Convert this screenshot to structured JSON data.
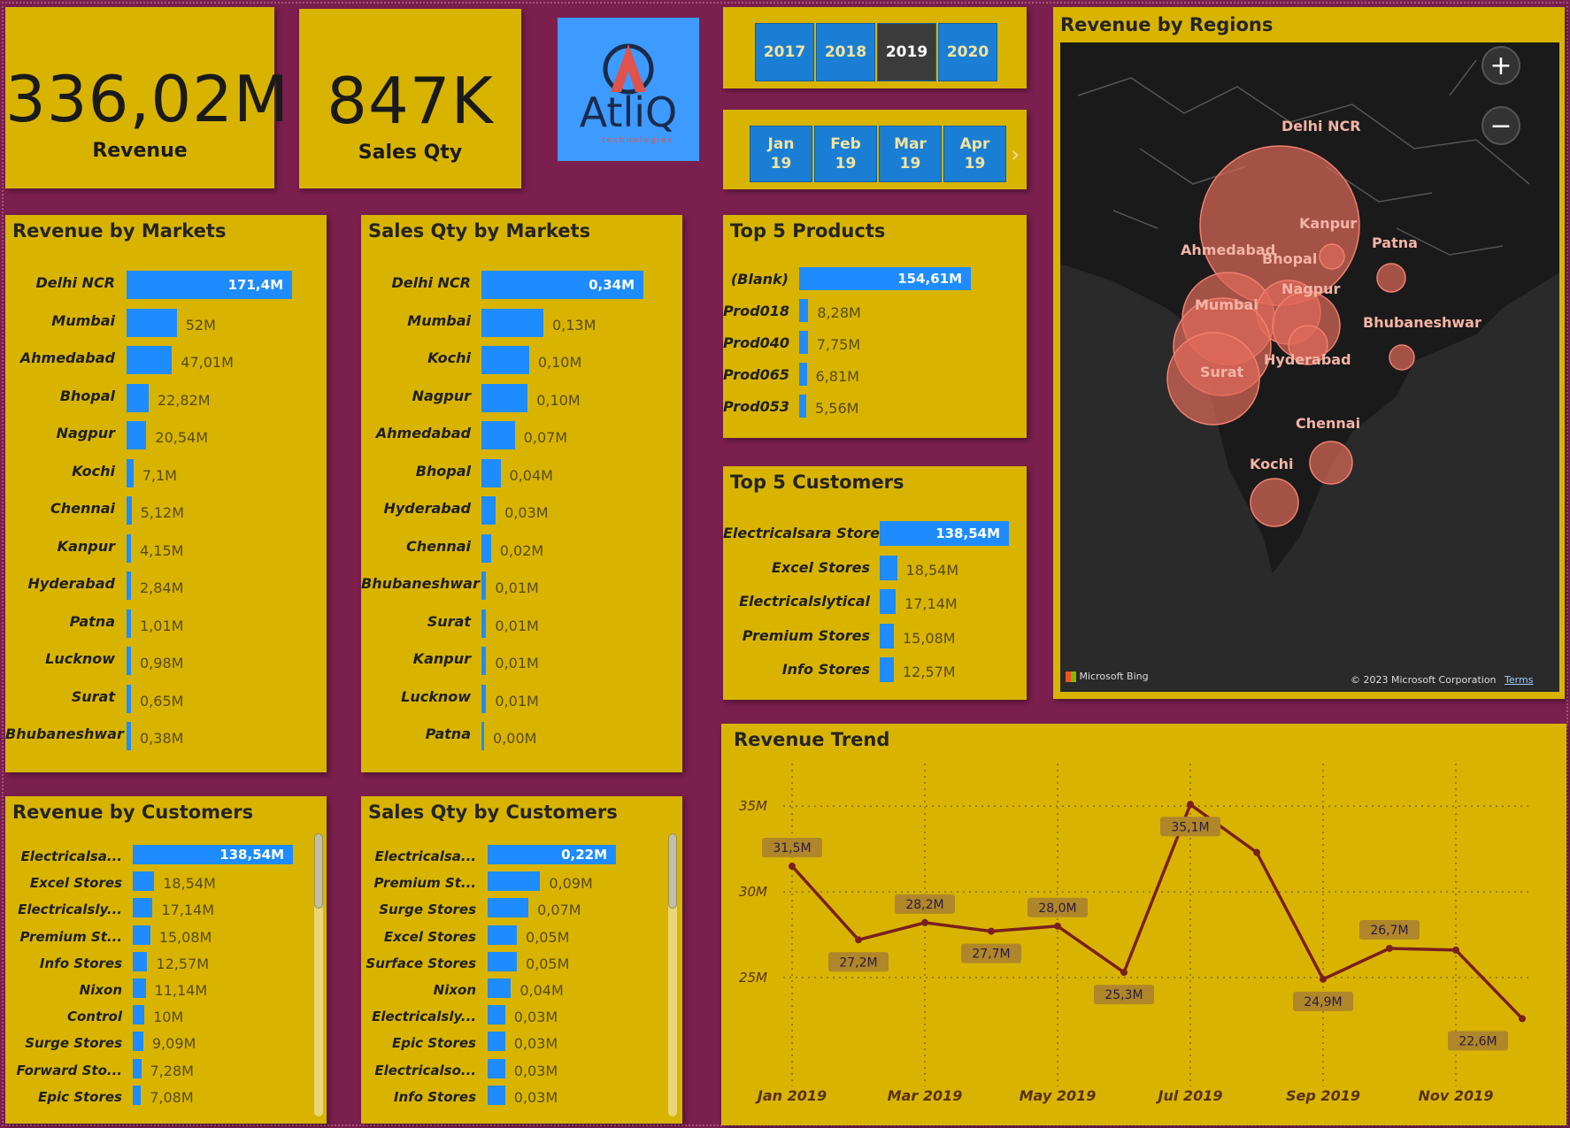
{
  "kpis": {
    "revenue": {
      "value": "336,02M",
      "label": "Revenue"
    },
    "sales_qty": {
      "value": "847K",
      "label": "Sales Qty"
    }
  },
  "logo": {
    "text": "AtliQ",
    "subtext": "technologies"
  },
  "year_slicer": {
    "options": [
      "2017",
      "2018",
      "2019",
      "2020"
    ],
    "selected": "2019"
  },
  "month_slicer": {
    "options": [
      {
        "m": "Jan",
        "y": "19"
      },
      {
        "m": "Feb",
        "y": "19"
      },
      {
        "m": "Mar",
        "y": "19"
      },
      {
        "m": "Apr",
        "y": "19"
      }
    ],
    "next_icon": "chevron-right-icon"
  },
  "revenue_by_markets": {
    "title": "Revenue by Markets",
    "rows": [
      {
        "label": "Delhi NCR",
        "value": 171.4,
        "text": "171,4M"
      },
      {
        "label": "Mumbai",
        "value": 52,
        "text": "52M"
      },
      {
        "label": "Ahmedabad",
        "value": 47.01,
        "text": "47,01M"
      },
      {
        "label": "Bhopal",
        "value": 22.82,
        "text": "22,82M"
      },
      {
        "label": "Nagpur",
        "value": 20.54,
        "text": "20,54M"
      },
      {
        "label": "Kochi",
        "value": 7.1,
        "text": "7,1M"
      },
      {
        "label": "Chennai",
        "value": 5.12,
        "text": "5,12M"
      },
      {
        "label": "Kanpur",
        "value": 4.15,
        "text": "4,15M"
      },
      {
        "label": "Hyderabad",
        "value": 2.84,
        "text": "2,84M"
      },
      {
        "label": "Patna",
        "value": 1.01,
        "text": "1,01M"
      },
      {
        "label": "Lucknow",
        "value": 0.98,
        "text": "0,98M"
      },
      {
        "label": "Surat",
        "value": 0.65,
        "text": "0,65M"
      },
      {
        "label": "Bhubaneshwar",
        "value": 0.38,
        "text": "0,38M"
      }
    ]
  },
  "sales_qty_by_markets": {
    "title": "Sales Qty by Markets",
    "rows": [
      {
        "label": "Delhi NCR",
        "value": 0.34,
        "text": "0,34M"
      },
      {
        "label": "Mumbai",
        "value": 0.13,
        "text": "0,13M"
      },
      {
        "label": "Kochi",
        "value": 0.1,
        "text": "0,10M"
      },
      {
        "label": "Nagpur",
        "value": 0.097,
        "text": "0,10M"
      },
      {
        "label": "Ahmedabad",
        "value": 0.07,
        "text": "0,07M"
      },
      {
        "label": "Bhopal",
        "value": 0.04,
        "text": "0,04M"
      },
      {
        "label": "Hyderabad",
        "value": 0.03,
        "text": "0,03M"
      },
      {
        "label": "Chennai",
        "value": 0.02,
        "text": "0,02M"
      },
      {
        "label": "Bhubaneshwar",
        "value": 0.01,
        "text": "0,01M"
      },
      {
        "label": "Surat",
        "value": 0.01,
        "text": "0,01M"
      },
      {
        "label": "Kanpur",
        "value": 0.01,
        "text": "0,01M"
      },
      {
        "label": "Lucknow",
        "value": 0.01,
        "text": "0,01M"
      },
      {
        "label": "Patna",
        "value": 0.004,
        "text": "0,00M"
      }
    ]
  },
  "top5_products": {
    "title": "Top 5 Products",
    "rows": [
      {
        "label": "(Blank)",
        "value": 154.61,
        "text": "154,61M"
      },
      {
        "label": "Prod018",
        "value": 8.28,
        "text": "8,28M"
      },
      {
        "label": "Prod040",
        "value": 7.75,
        "text": "7,75M"
      },
      {
        "label": "Prod065",
        "value": 6.81,
        "text": "6,81M"
      },
      {
        "label": "Prod053",
        "value": 5.56,
        "text": "5,56M"
      }
    ]
  },
  "top5_customers": {
    "title": "Top 5 Customers",
    "rows": [
      {
        "label": "Electricalsara Stores",
        "value": 138.54,
        "text": "138,54M"
      },
      {
        "label": "Excel Stores",
        "value": 18.54,
        "text": "18,54M"
      },
      {
        "label": "Electricalslytical",
        "value": 17.14,
        "text": "17,14M"
      },
      {
        "label": "Premium Stores",
        "value": 15.08,
        "text": "15,08M"
      },
      {
        "label": "Info Stores",
        "value": 12.57,
        "text": "12,57M"
      }
    ]
  },
  "revenue_by_customers": {
    "title": "Revenue by Customers",
    "scroll_position": 0.0,
    "rows": [
      {
        "label": "Electricalsa...",
        "value": 138.54,
        "text": "138,54M"
      },
      {
        "label": "Excel Stores",
        "value": 18.54,
        "text": "18,54M"
      },
      {
        "label": "Electricalsly...",
        "value": 17.14,
        "text": "17,14M"
      },
      {
        "label": "Premium St...",
        "value": 15.08,
        "text": "15,08M"
      },
      {
        "label": "Info Stores",
        "value": 12.57,
        "text": "12,57M"
      },
      {
        "label": "Nixon",
        "value": 11.14,
        "text": "11,14M"
      },
      {
        "label": "Control",
        "value": 10,
        "text": "10M"
      },
      {
        "label": "Surge Stores",
        "value": 9.09,
        "text": "9,09M"
      },
      {
        "label": "Forward Sto...",
        "value": 7.28,
        "text": "7,28M"
      },
      {
        "label": "Epic Stores",
        "value": 7.08,
        "text": "7,08M"
      }
    ]
  },
  "sales_qty_by_customers": {
    "title": "Sales Qty by Customers",
    "scroll_position": 0.0,
    "rows": [
      {
        "label": "Electricalsa...",
        "value": 0.22,
        "text": "0,22M"
      },
      {
        "label": "Premium St...",
        "value": 0.09,
        "text": "0,09M"
      },
      {
        "label": "Surge Stores",
        "value": 0.07,
        "text": "0,07M"
      },
      {
        "label": "Excel Stores",
        "value": 0.05,
        "text": "0,05M"
      },
      {
        "label": "Surface Stores",
        "value": 0.05,
        "text": "0,05M"
      },
      {
        "label": "Nixon",
        "value": 0.04,
        "text": "0,04M"
      },
      {
        "label": "Electricalsly...",
        "value": 0.03,
        "text": "0,03M"
      },
      {
        "label": "Epic Stores",
        "value": 0.03,
        "text": "0,03M"
      },
      {
        "label": "Electricalso...",
        "value": 0.03,
        "text": "0,03M"
      },
      {
        "label": "Info Stores",
        "value": 0.03,
        "text": "0,03M"
      }
    ]
  },
  "revenue_by_regions": {
    "title": "Revenue by Regions",
    "cities": [
      "Delhi NCR",
      "Kanpur",
      "Patna",
      "Ahmedabad",
      "Bhopal",
      "Nagpur",
      "Mumbai",
      "Bhubaneshwar",
      "Hyderabad",
      "Surat",
      "Chennai",
      "Kochi"
    ],
    "zoom_in_icon": "plus-icon",
    "zoom_out_icon": "minus-icon",
    "attribution_left": "Microsoft Bing",
    "attribution_right": "© 2023 Microsoft Corporation",
    "terms": "Terms"
  },
  "colors": {
    "card_bg": "#d8b400",
    "page_bg": "#7b1f4e",
    "bar": "#1e8cff",
    "trend_line": "#7a1f1f",
    "map_bubble": "#e0695a"
  },
  "chart_data": {
    "type": "line",
    "title": "Revenue Trend",
    "x": [
      "Jan 2019",
      "Feb 2019",
      "Mar 2019",
      "Apr 2019",
      "May 2019",
      "Jun 2019",
      "Jul 2019",
      "Aug 2019",
      "Sep 2019",
      "Oct 2019",
      "Nov 2019",
      "Dec 2019"
    ],
    "x_tick_labels": [
      "Jan 2019",
      "Mar 2019",
      "May 2019",
      "Jul 2019",
      "Sep 2019",
      "Nov 2019"
    ],
    "values": [
      31.5,
      27.2,
      28.2,
      27.7,
      28.0,
      25.3,
      35.1,
      32.3,
      24.9,
      26.7,
      26.6,
      22.6
    ],
    "data_labels": [
      "31,5M",
      "27,2M",
      "28,2M",
      "27,7M",
      "28,0M",
      "25,3M",
      "35,1M",
      "",
      "24,9M",
      "26,7M",
      "",
      "22,6M"
    ],
    "y_ticks": [
      "25M",
      "30M",
      "35M"
    ],
    "y_tick_values": [
      25,
      30,
      35
    ],
    "ylim": [
      22,
      36.2
    ],
    "grid": true
  }
}
